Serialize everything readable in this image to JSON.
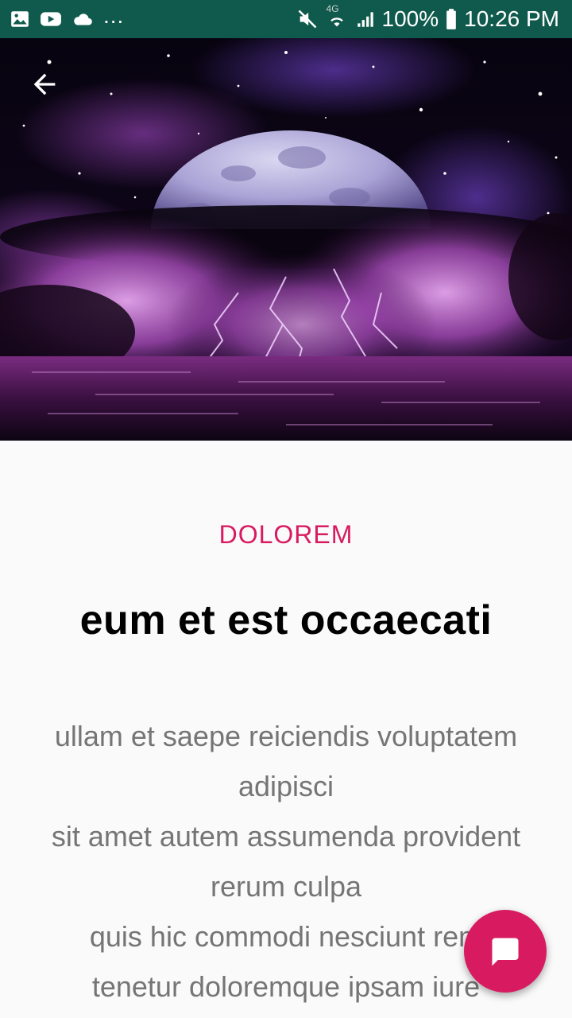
{
  "status_bar": {
    "battery": "100%",
    "time": "10:26 PM",
    "network": "4G",
    "overflow": "...",
    "icons": [
      "image-icon",
      "youtube-icon",
      "cloud-icon",
      "mute-icon",
      "wifi-icon",
      "signal-icon",
      "battery-icon"
    ]
  },
  "hero": {
    "image": "night-sky-moon-lightning-image",
    "back_icon": "arrow-left-icon"
  },
  "article": {
    "category": "DOLOREM",
    "title": "eum et est occaecati",
    "body_lines": [
      "ullam et saepe reiciendis voluptatem",
      "adipisci",
      "sit amet autem assumenda provident",
      "rerum culpa",
      "quis hic commodi nesciunt rem",
      "tenetur doloremque ipsam iure"
    ]
  },
  "fab": {
    "icon": "chat-icon"
  },
  "colors": {
    "status_bar": "#0f5a4c",
    "accent": "#d81b60",
    "background": "#fafafa",
    "body_text": "#757575"
  }
}
